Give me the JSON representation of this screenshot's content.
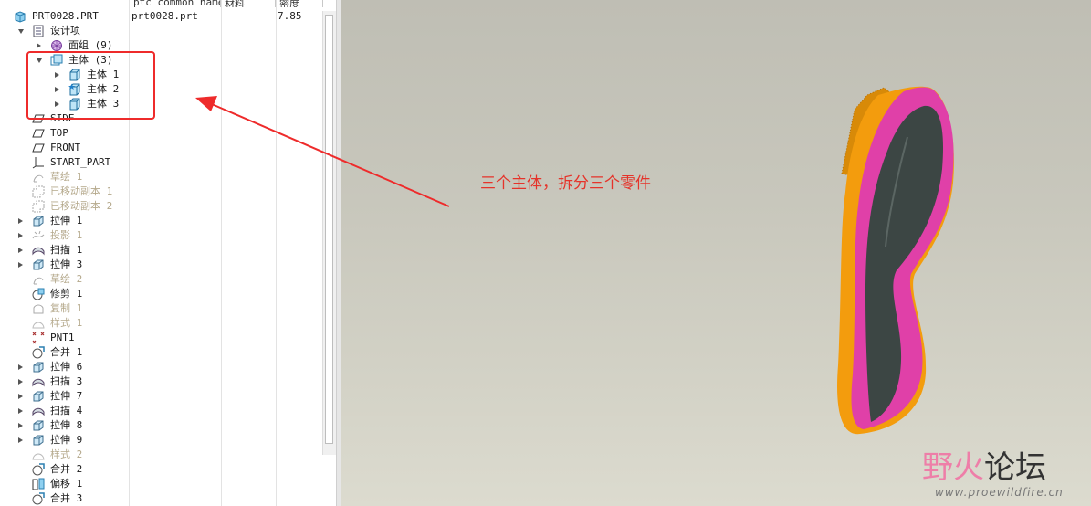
{
  "columns": {
    "tree": "",
    "common_name": "ptc_common_name",
    "material": "材料",
    "density": "密度"
  },
  "root": {
    "label": "PRT0028.PRT",
    "common_name": "prt0028.prt",
    "density": "7.85"
  },
  "tree_items": [
    {
      "label": "设计项",
      "icon": "design-items-icon",
      "toggle": "down",
      "dim": false
    },
    {
      "label": "面组 (9)",
      "icon": "quilt-group-icon",
      "toggle": "right",
      "dim": false
    },
    {
      "label": "主体 (3)",
      "icon": "bodies-folder-icon",
      "toggle": "down",
      "dim": false
    },
    {
      "label": "主体 1",
      "icon": "body-icon",
      "toggle": "right",
      "dim": false
    },
    {
      "label": "主体 2",
      "icon": "body-default-icon",
      "toggle": "right",
      "dim": false
    },
    {
      "label": "主体 3",
      "icon": "body-icon",
      "toggle": "right",
      "dim": false
    },
    {
      "label": "SIDE",
      "icon": "datum-plane-icon",
      "toggle": "",
      "dim": false
    },
    {
      "label": "TOP",
      "icon": "datum-plane-icon",
      "toggle": "",
      "dim": false
    },
    {
      "label": "FRONT",
      "icon": "datum-plane-icon",
      "toggle": "",
      "dim": false
    },
    {
      "label": "START_PART",
      "icon": "coordinate-system-icon",
      "toggle": "",
      "dim": false
    },
    {
      "label": "草绘 1",
      "icon": "sketch-icon",
      "toggle": "",
      "dim": true
    },
    {
      "label": "已移动副本 1",
      "icon": "moved-copy-icon",
      "toggle": "",
      "dim": true
    },
    {
      "label": "已移动副本 2",
      "icon": "moved-copy-icon",
      "toggle": "",
      "dim": true
    },
    {
      "label": "拉伸 1",
      "icon": "extrude-icon",
      "toggle": "right",
      "dim": false
    },
    {
      "label": "投影 1",
      "icon": "projection-icon",
      "toggle": "right",
      "dim": true
    },
    {
      "label": "扫描 1",
      "icon": "sweep-icon",
      "toggle": "right",
      "dim": false
    },
    {
      "label": "拉伸 3",
      "icon": "extrude-icon",
      "toggle": "right",
      "dim": false
    },
    {
      "label": "草绘 2",
      "icon": "sketch-icon",
      "toggle": "",
      "dim": true
    },
    {
      "label": "修剪 1",
      "icon": "trim-icon",
      "toggle": "",
      "dim": false
    },
    {
      "label": "复制 1",
      "icon": "copy-icon",
      "toggle": "",
      "dim": true
    },
    {
      "label": "样式 1",
      "icon": "style-icon",
      "toggle": "",
      "dim": true
    },
    {
      "label": "PNT1",
      "icon": "datum-point-icon",
      "toggle": "",
      "dim": false
    },
    {
      "label": "合并 1",
      "icon": "merge-icon",
      "toggle": "",
      "dim": false
    },
    {
      "label": "拉伸 6",
      "icon": "extrude-icon",
      "toggle": "right",
      "dim": false
    },
    {
      "label": "扫描 3",
      "icon": "sweep-icon",
      "toggle": "right",
      "dim": false
    },
    {
      "label": "拉伸 7",
      "icon": "extrude-icon",
      "toggle": "right",
      "dim": false
    },
    {
      "label": "扫描 4",
      "icon": "sweep-icon",
      "toggle": "right",
      "dim": false
    },
    {
      "label": "拉伸 8",
      "icon": "extrude-icon",
      "toggle": "right",
      "dim": false
    },
    {
      "label": "拉伸 9",
      "icon": "extrude-icon",
      "toggle": "right",
      "dim": false
    },
    {
      "label": "样式 2",
      "icon": "style-icon",
      "toggle": "",
      "dim": true
    },
    {
      "label": "合并 2",
      "icon": "merge-icon",
      "toggle": "",
      "dim": false
    },
    {
      "label": "偏移 1",
      "icon": "offset-icon",
      "toggle": "",
      "dim": false
    },
    {
      "label": "合并 3",
      "icon": "merge-icon",
      "toggle": "",
      "dim": false
    }
  ],
  "annotation": {
    "text": "三个主体，拆分三个零件",
    "color": "#e5332a"
  },
  "watermark": {
    "logo_part1": "野火",
    "logo_part2": "论坛",
    "url": "www.proewildfire.cn"
  },
  "colors": {
    "model_orange": "#f29a0b",
    "model_pink": "#e23fae",
    "model_dark": "#3a4442",
    "viewport_bg": "#c8c7bc"
  }
}
